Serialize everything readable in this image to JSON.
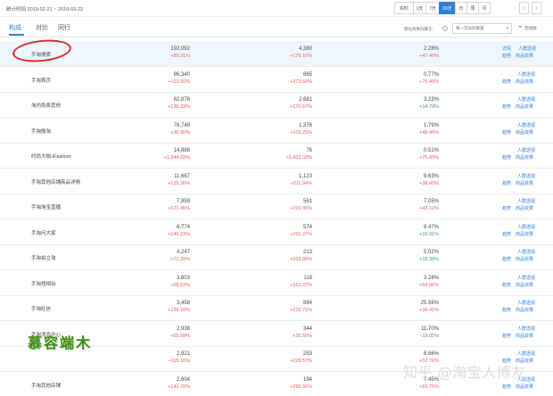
{
  "topbar": {
    "stat_time": "统计时间 2019-02-21 ~ 2019-03-22",
    "ranges": [
      "实时",
      "1天",
      "7天",
      "30天",
      "日",
      "周",
      "月"
    ],
    "active_range": "30天",
    "prev": "‹",
    "next": "›"
  },
  "tabs": [
    "构成",
    "对比",
    "同行"
  ],
  "active_tab": "构成",
  "source": {
    "label": "转化效果归属于：",
    "select_value": "每一次访问来源",
    "filter_label": "无线端"
  },
  "actions": {
    "crowd": "人群透视",
    "detail": "详情",
    "trend": "趋势",
    "effect": "商品效果"
  },
  "rows": [
    {
      "name": "手淘搜索",
      "c1": "192,092",
      "p1": "+89.31%",
      "c2": "4,380",
      "p2": "+179.16%",
      "c3": "2.28%",
      "p3": "+47.46%",
      "d3": "up",
      "detail": true
    },
    {
      "name": "手淘首页",
      "c1": "86,340",
      "p1": "+113.00%",
      "c2": "665",
      "p2": "+273.60%",
      "c3": "0.77%",
      "p3": "+75.40%",
      "d3": "up",
      "detail": false
    },
    {
      "name": "淘内免费其他",
      "c1": "82,878",
      "p1": "+138.33%",
      "c2": "2,681",
      "p2": "+170.57%",
      "c3": "3.23%",
      "p3": "+14.79%",
      "d3": "down",
      "detail": false
    },
    {
      "name": "手淘微淘",
      "c1": "76,748",
      "p1": "+36.90%",
      "c2": "1,376",
      "p2": "+103.25%",
      "c3": "1.79%",
      "p3": "+48.46%",
      "d3": "up",
      "detail": false
    },
    {
      "name": "时尚大咖-iFashion",
      "c1": "14,888",
      "p1": "+1,344.03%",
      "c2": "76",
      "p2": "+2,433.33%",
      "c3": "0.51%",
      "p3": "+75.43%",
      "d3": "up",
      "detail": false
    },
    {
      "name": "手淘其他店铺商品详情",
      "c1": "11,667",
      "p1": "+125.36%",
      "c2": "1,123",
      "p2": "+211.94%",
      "c3": "9.63%",
      "p3": "+38.42%",
      "d3": "up",
      "detail": false
    },
    {
      "name": "手淘淘宝直播",
      "c1": "7,959",
      "p1": "+121.45%",
      "c2": "561",
      "p2": "+216.95%",
      "c3": "7.05%",
      "p3": "+43.12%",
      "d3": "up",
      "detail": false
    },
    {
      "name": "手淘问大家",
      "c1": "6,774",
      "p1": "+149.23%",
      "c2": "574",
      "p2": "+291.37%",
      "c3": "8.47%",
      "p3": "+16.91%",
      "d3": "down",
      "detail": false
    },
    {
      "name": "手淘拍立淘",
      "c1": "4,247",
      "p1": "+71.39%",
      "c2": "213",
      "p2": "+102.86%",
      "c3": "5.02%",
      "p3": "+18.38%",
      "d3": "down",
      "detail": false
    },
    {
      "name": "手淘找相似",
      "c1": "3,603",
      "p1": "+58.63%",
      "c2": "118",
      "p2": "+162.22%",
      "c3": "3.28%",
      "p3": "+64.96%",
      "d3": "up",
      "detail": false
    },
    {
      "name": "手淘旺信",
      "c1": "3,458",
      "p1": "+128.10%",
      "c2": "884",
      "p2": "+215.71%",
      "c3": "25.56%",
      "p3": "+38.41%",
      "d3": "up",
      "detail": false
    },
    {
      "name": "手淘消息中心",
      "c1": "2,938",
      "p1": "+55.08%",
      "c2": "344",
      "p2": "+25.55%",
      "c3": "11.70%",
      "p3": "-19.05%",
      "d3": "down",
      "detail": false
    },
    {
      "name": "",
      "c1": "2,921",
      "p1": "+115.10%",
      "c2": "253",
      "p2": "+228.57%",
      "c3": "8.66%",
      "p3": "+52.76%",
      "d3": "up",
      "detail": false
    },
    {
      "name": "手淘其他店铺",
      "c1": "2,604",
      "p1": "+141.78%",
      "c2": "194",
      "p2": "+295.92%",
      "c3": "7.45%",
      "p3": "+63.75%",
      "d3": "up",
      "detail": false
    }
  ],
  "watermarks": {
    "green": "慕容端木",
    "zhihu": "知乎 @淘宝人博友"
  }
}
